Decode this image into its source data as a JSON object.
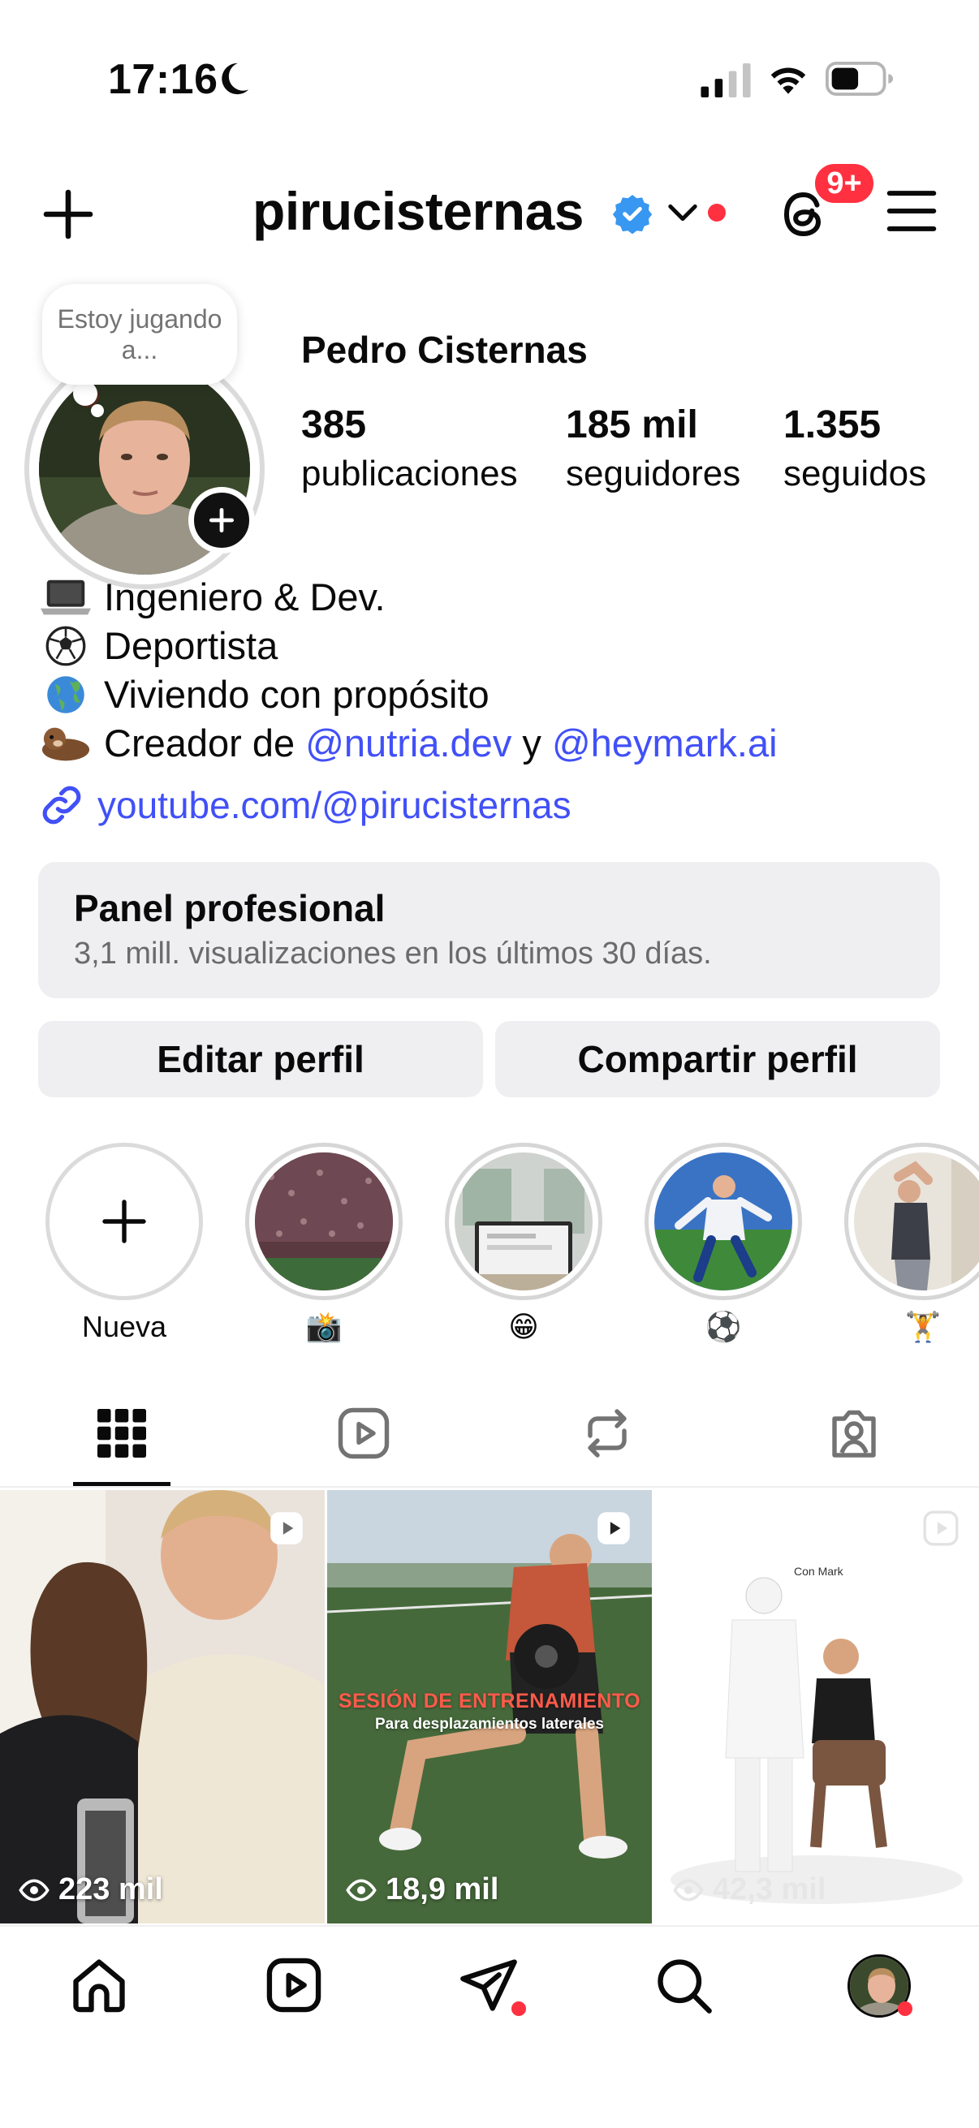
{
  "status_bar": {
    "time": "17:16"
  },
  "header": {
    "username": "pirucisternas",
    "notification_count": "9+"
  },
  "profile": {
    "note": "Estoy jugando a...",
    "full_name": "Pedro Cisternas",
    "stats": [
      {
        "value": "385",
        "label": "publicaciones"
      },
      {
        "value": "185 mil",
        "label": "seguidores"
      },
      {
        "value": "1.355",
        "label": "seguidos"
      }
    ],
    "bio": {
      "line1": "Ingeniero & Dev.",
      "line2": "Deportista",
      "line3": "Viviendo con propósito",
      "line4_prefix": "Creador de ",
      "line4_mention1": "@nutria.dev",
      "line4_mid": " y ",
      "line4_mention2": "@heymark.ai"
    },
    "link": "youtube.com/@pirucisternas"
  },
  "panel": {
    "title": "Panel profesional",
    "subtitle": "3,1 mill. visualizaciones en los últimos 30 días."
  },
  "buttons": {
    "edit": "Editar perfil",
    "share": "Compartir perfil"
  },
  "highlights": [
    {
      "label": "Nueva"
    },
    {
      "label": "📸"
    },
    {
      "label": "😁"
    },
    {
      "label": "⚽"
    },
    {
      "label": "🏋️"
    }
  ],
  "grid": [
    {
      "views": "223 mil"
    },
    {
      "views": "18,9 mil",
      "overlay_title": "SESIÓN DE ENTRENAMIENTO",
      "overlay_sub": "Para desplazamientos laterales"
    },
    {
      "views": "42,3 mil",
      "overlay_label": "Con Mark"
    }
  ],
  "colors": {
    "accent_link": "#4150f7",
    "notification": "#ff3040",
    "surface": "#efeff1",
    "verified": "#3897f0"
  }
}
